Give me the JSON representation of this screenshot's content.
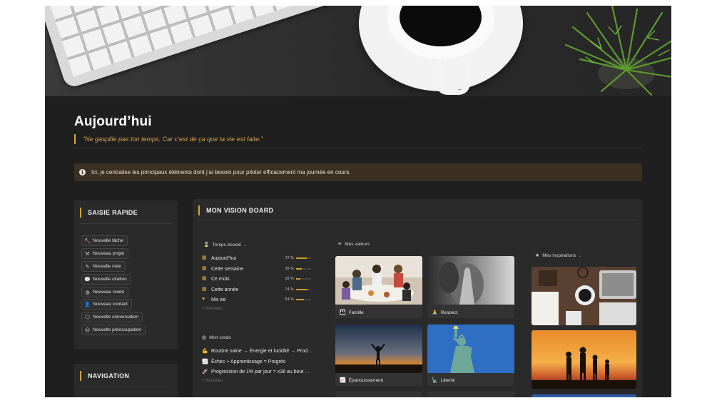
{
  "page": {
    "title": "Aujourd’hui",
    "quote": "“Ne gaspille pas ton temps. Car c’est de ça que ta vie est faite.”",
    "callout": {
      "icon": "info-icon",
      "text": "Ici, je centralise les principaux éléments dont j’ai besoin pour piloter efficacement ma journée en cours."
    }
  },
  "quick_entry": {
    "title": "SAISIE RAPIDE",
    "buttons": [
      {
        "icon": "hammer-icon",
        "glyph": "🔨",
        "label": "Nouvelle tâche"
      },
      {
        "icon": "project-icon",
        "glyph": "⚒",
        "label": "Nouveau projet"
      },
      {
        "icon": "note-icon",
        "glyph": "✎",
        "label": "Nouvelle note"
      },
      {
        "icon": "quote-bubble-icon",
        "glyph": "💬",
        "label": "Nouvelle citation"
      },
      {
        "icon": "credo-icon",
        "glyph": "◍",
        "label": "Nouveau credo"
      },
      {
        "icon": "person-icon",
        "glyph": "👤",
        "label": "Nouveau contact"
      },
      {
        "icon": "conversation-icon",
        "glyph": "🗨",
        "label": "Nouvelle conversation"
      },
      {
        "icon": "worry-icon",
        "glyph": "☹",
        "label": "Nouvelle préoccupation"
      }
    ]
  },
  "navigation": {
    "title": "NAVIGATION"
  },
  "vision_board": {
    "title": "MON VISION BOARD",
    "time_elapsed": {
      "heading": "Temps écoulé",
      "icon": "hourglass-icon",
      "rows": [
        {
          "icon": "calendar-icon",
          "glyph": "📅",
          "label": "Aujourd’hui",
          "percent_text": "72 %",
          "percent": 72
        },
        {
          "icon": "calendar-icon",
          "glyph": "📅",
          "label": "Cette semaine",
          "percent_text": "39 %",
          "percent": 39
        },
        {
          "icon": "calendar-icon",
          "glyph": "📅",
          "label": "Ce mois",
          "percent_text": "28 %",
          "percent": 28
        },
        {
          "icon": "calendar-icon",
          "glyph": "📅",
          "label": "Cette année",
          "percent_text": "74 %",
          "percent": 74
        },
        {
          "icon": "heart-icon",
          "glyph": "♥",
          "label": "Ma vie",
          "percent_text": "54 %",
          "percent": 54
        }
      ],
      "new_label": "+ Nouveau"
    },
    "credo": {
      "heading": "Mon credo",
      "icon": "credo-icon",
      "rows": [
        {
          "icon": "muscle-icon",
          "glyph": "💪",
          "label": "Routine saine → Énergie et lucidité → Prod…"
        },
        {
          "icon": "chart-up-icon",
          "glyph": "📈",
          "label": "Échec + Apprentissage = Progrès"
        },
        {
          "icon": "rocket-icon",
          "glyph": "🚀",
          "label": "Progression de 1% par jour = x38 au bout …"
        }
      ],
      "new_label": "+ Nouveau"
    },
    "values": {
      "heading": "Mes valeurs",
      "icon": "sun-icon",
      "cards": [
        {
          "caption": "Famille",
          "icon": "family-icon",
          "glyph": "👪"
        },
        {
          "caption": "Respect",
          "icon": "hands-icon",
          "glyph": "🙏"
        },
        {
          "caption": "Épanouissement",
          "icon": "chart-icon",
          "glyph": "📈"
        },
        {
          "caption": "Liberté",
          "icon": "statue-icon",
          "glyph": "🗽"
        }
      ]
    },
    "inspirations": {
      "heading": "Mes inspirations",
      "icon": "star-icon"
    }
  },
  "colors": {
    "background": "#1f1f1f",
    "panel": "#2a2a2a",
    "accent": "#d4a53a",
    "callout": "#3b3021"
  }
}
